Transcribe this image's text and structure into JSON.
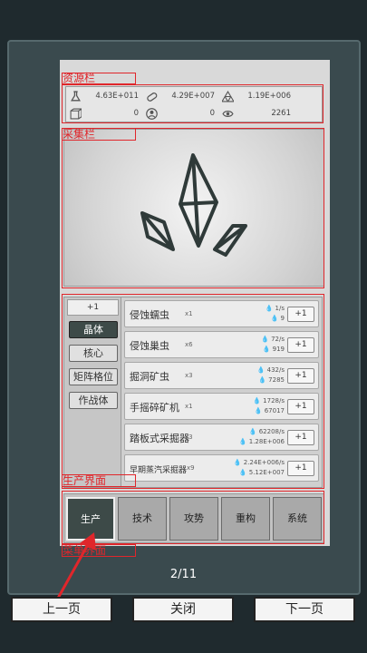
{
  "resources": {
    "row1": [
      {
        "icon": "flask-icon",
        "value": "4.63E+011"
      },
      {
        "icon": "pill-icon",
        "value": "4.29E+007"
      },
      {
        "icon": "triangle-cluster-icon",
        "value": "1.19E+006"
      }
    ],
    "row2": [
      {
        "icon": "box-icon",
        "value": "0"
      },
      {
        "icon": "person-icon",
        "value": "0"
      },
      {
        "icon": "eye-icon",
        "value": "2261"
      }
    ]
  },
  "annotations": {
    "resource_bar": "资源栏",
    "collect_bar": "采集栏",
    "production_ui": "生产界面",
    "menu_ui": "菜单界面"
  },
  "production": {
    "multiplier": "+1",
    "categories": [
      "晶体",
      "核心",
      "矩阵格位",
      "作战体"
    ],
    "units": [
      {
        "name": "侵蚀蠕虫",
        "count": "x1",
        "rate": "1/s",
        "cost": "9",
        "add": "+1"
      },
      {
        "name": "侵蚀巢虫",
        "count": "x6",
        "rate": "72/s",
        "cost": "919",
        "add": "+1"
      },
      {
        "name": "掘洞矿虫",
        "count": "x3",
        "rate": "432/s",
        "cost": "7285",
        "add": "+1"
      },
      {
        "name": "手摇碎矿机",
        "count": "x1",
        "rate": "1728/s",
        "cost": "67017",
        "add": "+1"
      },
      {
        "name": "踏板式采掘器",
        "count": "x3",
        "rate": "62208/s",
        "cost": "1.28E+006",
        "add": "+1"
      },
      {
        "name": "早期蒸汽采掘器",
        "count": "x9",
        "rate": "2.24E+006/s",
        "cost": "5.12E+007",
        "add": "+1"
      }
    ]
  },
  "nav_tabs": [
    "生产",
    "技术",
    "攻势",
    "重构",
    "系统"
  ],
  "page_indicator": "2/11",
  "buttons": {
    "prev": "上一页",
    "close": "关闭",
    "next": "下一页"
  },
  "colors": {
    "annotation": "#e0262b",
    "active_tab": "#3d4a48",
    "frame": "#3a4a4e"
  }
}
